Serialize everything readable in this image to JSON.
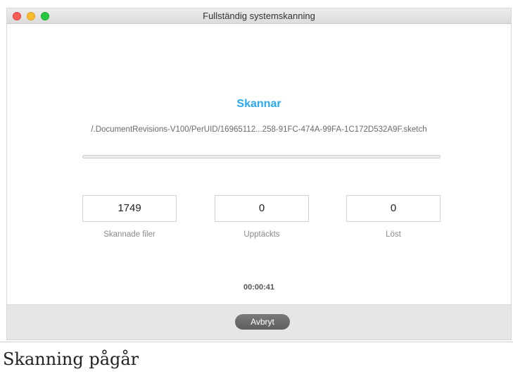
{
  "window": {
    "title": "Fullständig systemskanning"
  },
  "scan": {
    "heading": "Skannar",
    "current_path": "/.DocumentRevisions-V100/PerUID/16965112...258-91FC-474A-99FA-1C172D532A9F.sketch",
    "progress": 0
  },
  "stats": [
    {
      "value": "1749",
      "label": "Skannade filer"
    },
    {
      "value": "0",
      "label": "Upptäckts"
    },
    {
      "value": "0",
      "label": "Löst"
    }
  ],
  "timer": "00:00:41",
  "footer": {
    "cancel_label": "Avbryt"
  },
  "caption": "Skanning pågår",
  "colors": {
    "accent": "#29a9f0",
    "button": "#666666"
  }
}
